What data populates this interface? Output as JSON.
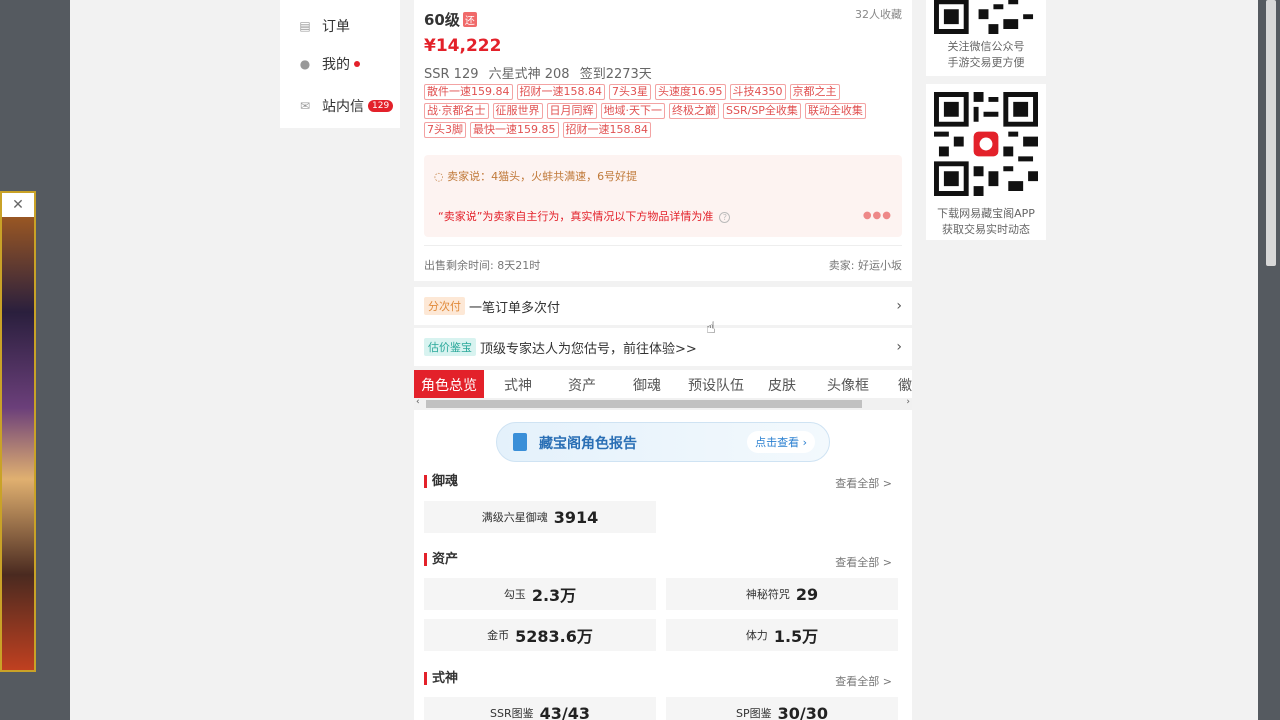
{
  "nav": {
    "orders": "订单",
    "mine": "我的",
    "inbox": "站内信",
    "inbox_badge": "129"
  },
  "product": {
    "level": "60级",
    "level_tag": "还",
    "favorites": "32人收藏",
    "price": "¥14,222",
    "stats": [
      "SSR 129",
      "六星式神 208",
      "签到2273天"
    ],
    "tags": [
      "散件一速159.84",
      "招财一速158.84",
      "7头3星",
      "头速度16.95",
      "斗技4350",
      "京都之主",
      "战·京都名士",
      "征服世界",
      "日月同辉",
      "地域·天下一",
      "终极之巅",
      "SSR/SP全收集",
      "联动全收集",
      "7头3脚",
      "最快一速159.85",
      "招财一速158.84"
    ],
    "seller_say": "卖家说：4猫头，火蚌共满速，6号好提",
    "disclaimer": "“卖家说”为卖家自主行为，真实情况以下方物品详情为准",
    "remaining": "出售剩余时间: 8天21时",
    "seller": "卖家: 好运小坂"
  },
  "installment": {
    "pill": "分次付",
    "text": "一笔订单多次付"
  },
  "appraisal": {
    "pill": "估价鉴宝",
    "text": "顶级专家达人为您估号，前往体验>>"
  },
  "tabs": [
    "角色总览",
    "式神",
    "资产",
    "御魂",
    "预设队伍",
    "皮肤",
    "头像框",
    "徽"
  ],
  "report": {
    "title": "藏宝阁角色报告",
    "button": "点击查看 ›"
  },
  "sections": {
    "yuhun": {
      "title": "御魂",
      "view_all": "查看全部 >",
      "items": [
        {
          "label": "满级六星御魂",
          "value": "3914"
        }
      ]
    },
    "assets": {
      "title": "资产",
      "view_all": "查看全部 >",
      "items": [
        {
          "label": "勾玉",
          "value": "2.3万"
        },
        {
          "label": "神秘符咒",
          "value": "29"
        },
        {
          "label": "金币",
          "value": "5283.6万"
        },
        {
          "label": "体力",
          "value": "1.5万"
        }
      ]
    },
    "shikigami": {
      "title": "式神",
      "view_all": "查看全部 >",
      "items": [
        {
          "label": "SSR图鉴",
          "value": "43/43"
        },
        {
          "label": "SP图鉴",
          "value": "30/30"
        }
      ]
    }
  },
  "qr1": {
    "line1": "关注微信公众号",
    "line2": "手游交易更方便"
  },
  "qr2": {
    "line1": "下载网易藏宝阁APP",
    "line2": "获取交易实时动态"
  },
  "colors": {
    "accent": "#e3212a",
    "seller_box": "#fdf3f1",
    "tag_border": "#f3a3a3"
  }
}
